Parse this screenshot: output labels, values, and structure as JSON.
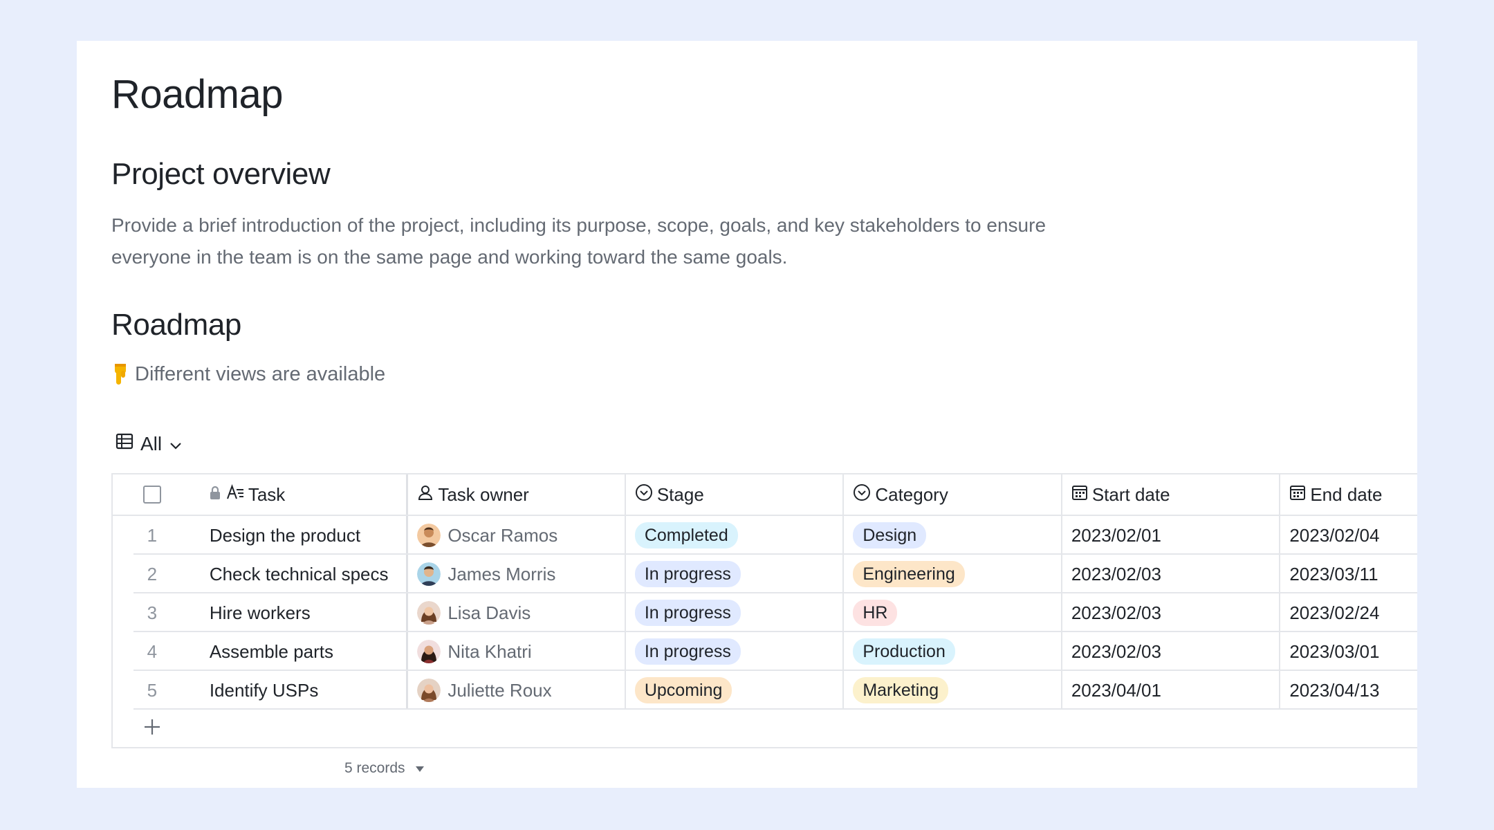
{
  "doc": {
    "title": "Roadmap",
    "overview_heading": "Project overview",
    "overview_text": "Provide a brief introduction of the project, including its purpose, scope, goals, and key stakeholders to ensure everyone in the team is on the same page and working toward the same goals.",
    "roadmap_heading": "Roadmap",
    "hint_text": "Different views are available",
    "hint_icon": "pointing-down-hand-icon"
  },
  "view": {
    "label": "All",
    "icon": "grid-table-icon"
  },
  "table": {
    "columns": [
      {
        "label": "Task",
        "icon": "text-field-icon"
      },
      {
        "label": "Task owner",
        "icon": "person-icon"
      },
      {
        "label": "Stage",
        "icon": "single-select-icon"
      },
      {
        "label": "Category",
        "icon": "single-select-icon"
      },
      {
        "label": "Start date",
        "icon": "calendar-icon"
      },
      {
        "label": "End date",
        "icon": "calendar-icon"
      }
    ],
    "rows": [
      {
        "idx": "1",
        "task": "Design the product",
        "owner": "Oscar Ramos",
        "stage": "Completed",
        "category": "Design",
        "start": "2023/02/01",
        "end": "2023/02/04"
      },
      {
        "idx": "2",
        "task": "Check technical specs",
        "owner": "James Morris",
        "stage": "In progress",
        "category": "Engineering",
        "start": "2023/02/03",
        "end": "2023/03/11"
      },
      {
        "idx": "3",
        "task": "Hire workers",
        "owner": "Lisa Davis",
        "stage": "In progress",
        "category": "HR",
        "start": "2023/02/03",
        "end": "2023/02/24"
      },
      {
        "idx": "4",
        "task": "Assemble parts",
        "owner": "Nita Khatri",
        "stage": "In progress",
        "category": "Production",
        "start": "2023/02/03",
        "end": "2023/03/01"
      },
      {
        "idx": "5",
        "task": "Identify USPs",
        "owner": "Juliette Roux",
        "stage": "Upcoming",
        "category": "Marketing",
        "start": "2023/04/01",
        "end": "2023/04/13"
      }
    ],
    "add_row_icon": "plus-icon",
    "records_label": "5 records"
  },
  "colors": {
    "page_bg": "#e8eefc",
    "stage_completed": "#d9f3fd",
    "stage_in_progress": "#e0e9ff",
    "stage_upcoming": "#fde6c8",
    "cat_design": "#e0e9ff",
    "cat_engineering": "#fde6c8",
    "cat_hr": "#fde2e2",
    "cat_production": "#d9f3fd",
    "cat_marketing": "#fcf1cc"
  }
}
